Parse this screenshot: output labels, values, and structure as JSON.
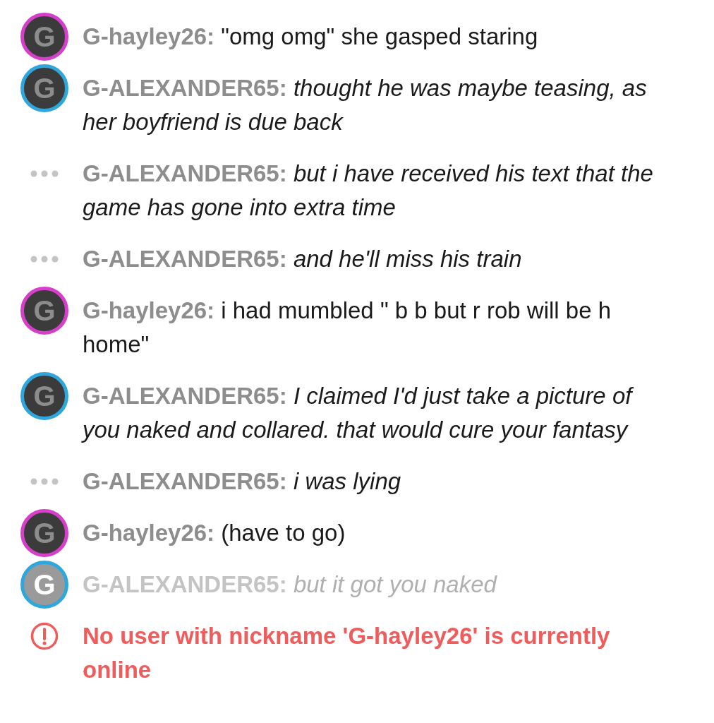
{
  "messages": [
    {
      "kind": "avatar",
      "avatar_letter": "G",
      "color": "#d63fc9",
      "sender": "G-hayley26:",
      "text": "\"omg omg\" she gasped staring",
      "italic": false,
      "faded": false
    },
    {
      "kind": "avatar",
      "avatar_letter": "G",
      "color": "#2fa7dd",
      "sender": "G-ALEXANDER65:",
      "text": "thought he was maybe teasing, as her boyfriend is due back",
      "italic": true,
      "faded": false
    },
    {
      "kind": "continuation",
      "sender": "G-ALEXANDER65:",
      "text": "but i have received his text that the game has gone into extra time",
      "italic": true,
      "faded": false
    },
    {
      "kind": "continuation",
      "sender": "G-ALEXANDER65:",
      "text": "and he'll miss his train",
      "italic": true,
      "faded": false
    },
    {
      "kind": "avatar",
      "avatar_letter": "G",
      "color": "#d63fc9",
      "sender": "G-hayley26:",
      "text": "i had mumbled \" b b but r rob will be h home\"",
      "italic": false,
      "faded": false
    },
    {
      "kind": "avatar",
      "avatar_letter": "G",
      "color": "#2fa7dd",
      "sender": "G-ALEXANDER65:",
      "text": "I claimed I'd just take a picture of you naked and collared. that would cure your fantasy",
      "italic": true,
      "faded": false
    },
    {
      "kind": "continuation",
      "sender": "G-ALEXANDER65:",
      "text": "i was lying",
      "italic": true,
      "faded": false
    },
    {
      "kind": "avatar",
      "avatar_letter": "G",
      "color": "#d63fc9",
      "sender": "G-hayley26:",
      "text": "(have to go)",
      "italic": false,
      "faded": false
    },
    {
      "kind": "avatar",
      "avatar_letter": "G",
      "color": "#2fa7dd",
      "sender": "G-ALEXANDER65:",
      "text": "but it got you naked",
      "italic": true,
      "faded": true
    }
  ],
  "error": {
    "text": "No user with nickname 'G-hayley26' is currently online"
  }
}
